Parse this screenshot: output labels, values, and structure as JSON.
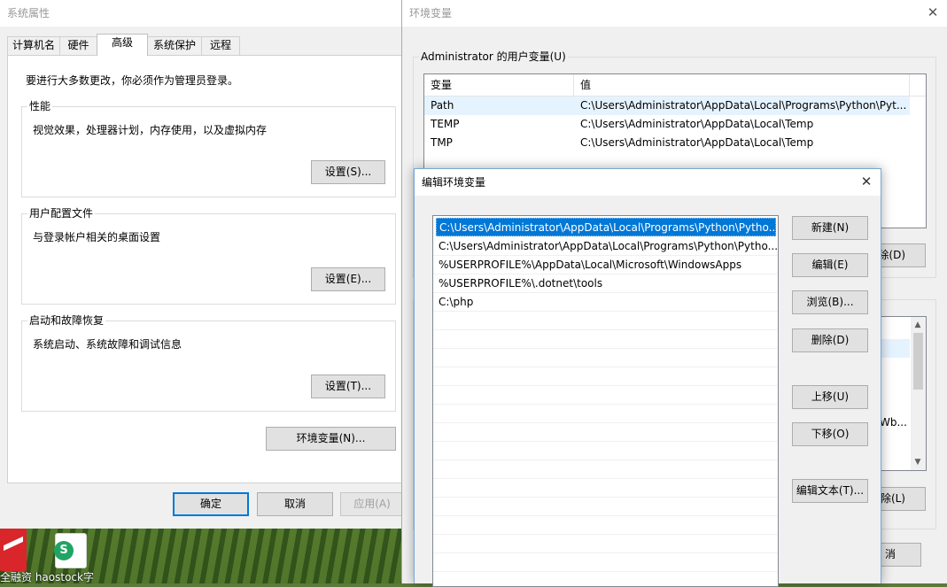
{
  "desktop": {
    "shortcut_label": "全融资 haostock字"
  },
  "system_properties": {
    "title": "系统属性",
    "tabs": [
      "计算机名",
      "硬件",
      "高级",
      "系统保护",
      "远程"
    ],
    "selected_tab": "高级",
    "admin_note": "要进行大多数更改，你必须作为管理员登录。",
    "performance": {
      "label": "性能",
      "description": "视觉效果，处理器计划，内存使用，以及虚拟内存",
      "button": "设置(S)..."
    },
    "user_profiles": {
      "label": "用户配置文件",
      "description": "与登录帐户相关的桌面设置",
      "button": "设置(E)..."
    },
    "startup_recovery": {
      "label": "启动和故障恢复",
      "description": "系统启动、系统故障和调试信息",
      "button": "设置(T)..."
    },
    "env_button": "环境变量(N)...",
    "ok": "确定",
    "cancel": "取消",
    "apply": "应用(A)"
  },
  "environment_variables": {
    "title": "环境变量",
    "user_vars_label": "Administrator 的用户变量(U)",
    "col_var": "变量",
    "col_value": "值",
    "user_vars": [
      {
        "name": "Path",
        "value": "C:\\Users\\Administrator\\AppData\\Local\\Programs\\Python\\Pyt..."
      },
      {
        "name": "TEMP",
        "value": "C:\\Users\\Administrator\\AppData\\Local\\Temp"
      },
      {
        "name": "TMP",
        "value": "C:\\Users\\Administrator\\AppData\\Local\\Temp"
      }
    ],
    "user_delete_partial": "除(D)",
    "system_value_partial": "Wb...",
    "system_delete_partial": "除(L)",
    "cancel_partial": "消"
  },
  "edit_dialog": {
    "title": "编辑环境变量",
    "paths": [
      "C:\\Users\\Administrator\\AppData\\Local\\Programs\\Python\\Pytho...",
      "C:\\Users\\Administrator\\AppData\\Local\\Programs\\Python\\Pytho...",
      "%USERPROFILE%\\AppData\\Local\\Microsoft\\WindowsApps",
      "%USERPROFILE%\\.dotnet\\tools",
      "C:\\php"
    ],
    "buttons": {
      "new": "新建(N)",
      "edit": "编辑(E)",
      "browse": "浏览(B)...",
      "delete": "删除(D)",
      "move_up": "上移(U)",
      "move_down": "下移(O)",
      "edit_text": "编辑文本(T)..."
    }
  }
}
